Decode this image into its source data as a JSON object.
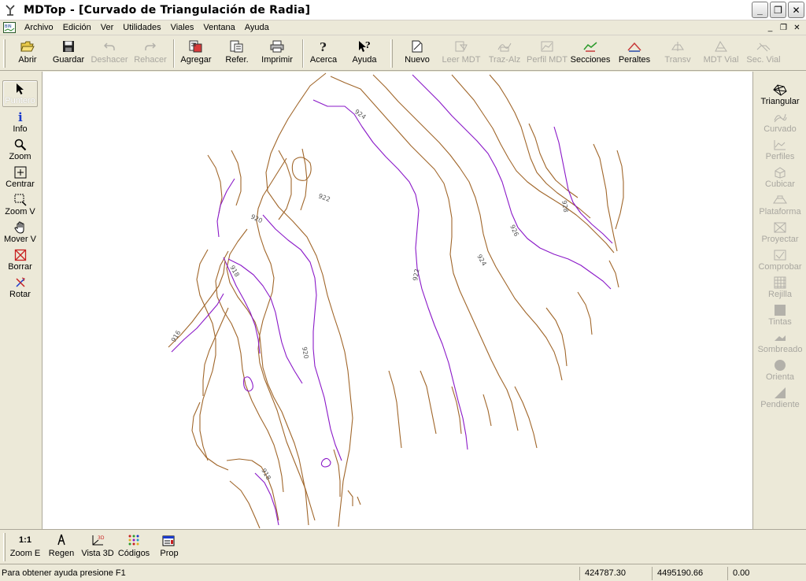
{
  "window": {
    "title": "MDTop - [Curvado de Triangulación de Radia]",
    "minimize": "_",
    "maximize": "❐",
    "close": "✕"
  },
  "menu": {
    "items": [
      "Archivo",
      "Edición",
      "Ver",
      "Utilidades",
      "Viales",
      "Ventana",
      "Ayuda"
    ],
    "mdi_minimize": "_",
    "mdi_restore": "❐",
    "mdi_close": "✕"
  },
  "toolbar": {
    "abrir": "Abrir",
    "guardar": "Guardar",
    "deshacer": "Deshacer",
    "rehacer": "Rehacer",
    "agregar": "Agregar",
    "refer": "Refer.",
    "imprimir": "Imprimir",
    "acerca": "Acerca",
    "ayuda": "Ayuda",
    "nuevo": "Nuevo",
    "leer_mdt": "Leer MDT",
    "traz_alz": "Traz-Alz",
    "perfil_mdt": "Perfil MDT",
    "secciones": "Secciones",
    "peraltes": "Peraltes",
    "transv": "Transv",
    "mdt_vial": "MDT Vial",
    "sec_vial": "Sec. Vial"
  },
  "left_tools": {
    "puntero": "Puntero",
    "info": "Info",
    "zoom": "Zoom",
    "centrar": "Centrar",
    "zoom_v": "Zoom V",
    "mover_v": "Mover V",
    "borrar": "Borrar",
    "rotar": "Rotar"
  },
  "right_tools": {
    "triangular": "Triangular",
    "curvado": "Curvado",
    "perfiles": "Perfiles",
    "cubicar": "Cubicar",
    "plataforma": "Plataforma",
    "proyectar": "Proyectar",
    "comprobar": "Comprobar",
    "rejilla": "Rejilla",
    "tintas": "Tintas",
    "sombreado": "Sombreado",
    "orienta": "Orienta",
    "pendiente": "Pendiente"
  },
  "bottom_tools": {
    "zoom_e_icon": "1:1",
    "zoom_e": "Zoom E",
    "regen": "Regen",
    "vista_3d": "Vista 3D",
    "codigos": "Códigos",
    "prop": "Prop"
  },
  "status": {
    "help": "Para obtener ayuda presione F1",
    "x": "424787.30",
    "y": "4495190.66",
    "z": "0.00"
  },
  "contour_labels": [
    "924",
    "922",
    "920",
    "918",
    "916",
    "922",
    "924",
    "926",
    "928",
    "920",
    "918"
  ],
  "colors": {
    "contour_minor": "#a0662a",
    "contour_major": "#8a18c8",
    "window_bg": "#ece9d8",
    "disabled_text": "#a9a7a0"
  }
}
